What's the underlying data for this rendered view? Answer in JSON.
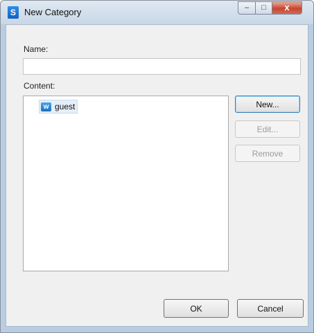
{
  "window": {
    "title": "New Category",
    "app_icon_glyph": "S",
    "controls": {
      "minimize": "–",
      "maximize": "□",
      "close": "x"
    }
  },
  "form": {
    "name_label": "Name:",
    "name_value": "",
    "content_label": "Content:",
    "content_items": [
      {
        "icon": "w",
        "label": "guest"
      }
    ]
  },
  "side_buttons": {
    "new": "New...",
    "edit": "Edit...",
    "remove": "Remove"
  },
  "footer": {
    "ok": "OK",
    "cancel": "Cancel"
  },
  "colors": {
    "title_bar": "#c9d7e6",
    "dialog_bg": "#f0f0f0",
    "close_button": "#c74530",
    "default_button_border": "#3c7fb1"
  }
}
